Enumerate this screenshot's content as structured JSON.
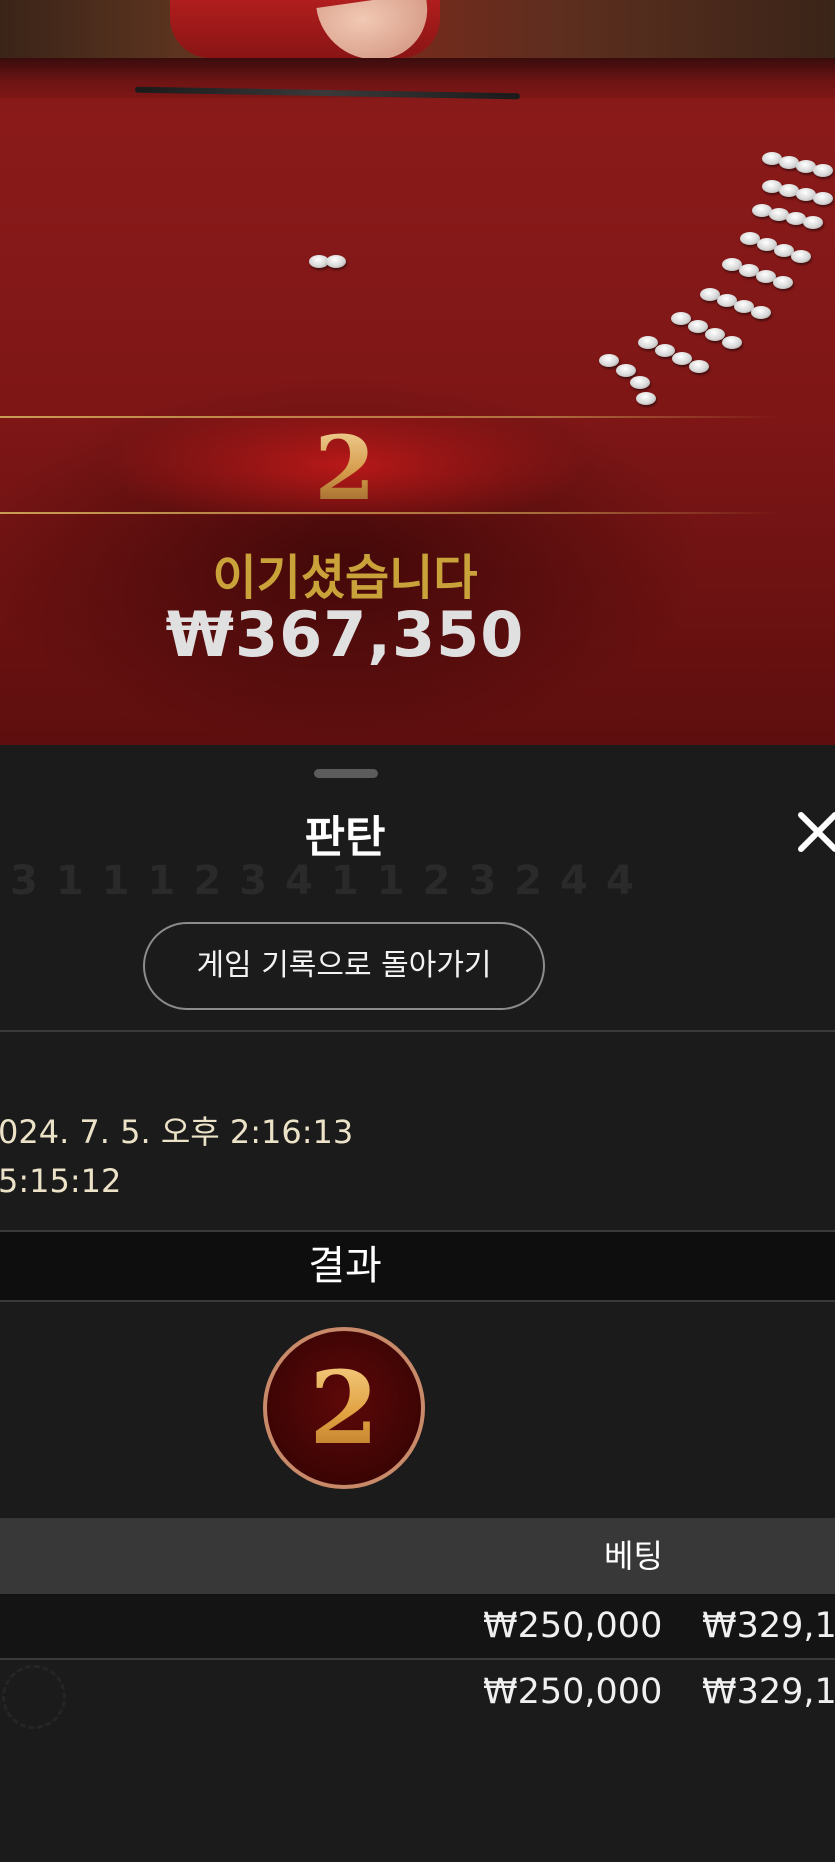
{
  "table": {
    "round_number": "2",
    "win_label": "이기셨습니다",
    "win_amount": "₩367,350"
  },
  "sheet": {
    "title": "판탄",
    "ghost_digits": [
      "3",
      "1",
      "1",
      "1",
      "2",
      "3",
      "4",
      "1",
      "1",
      "2",
      "3",
      "2",
      "4",
      "4"
    ],
    "back_button_label": "게임 기록으로 돌아가기",
    "datetime": "024. 7. 5. 오후 2:16:13",
    "round_id": "5:15:12",
    "result_header": "결과",
    "result_value": "2",
    "bet_header": "베팅",
    "bets": [
      {
        "amount": "₩250,000",
        "payout": "₩329,1("
      },
      {
        "amount": "₩250,000",
        "payout": "₩329,1("
      }
    ]
  },
  "colors": {
    "table_felt": "#7e1616",
    "win_label": "#c9a23a",
    "sheet_bg": "#1b1b1b",
    "header_bar": "#383838",
    "result_bar": "#0e0e0e"
  },
  "icons": {
    "close": "close-icon"
  }
}
